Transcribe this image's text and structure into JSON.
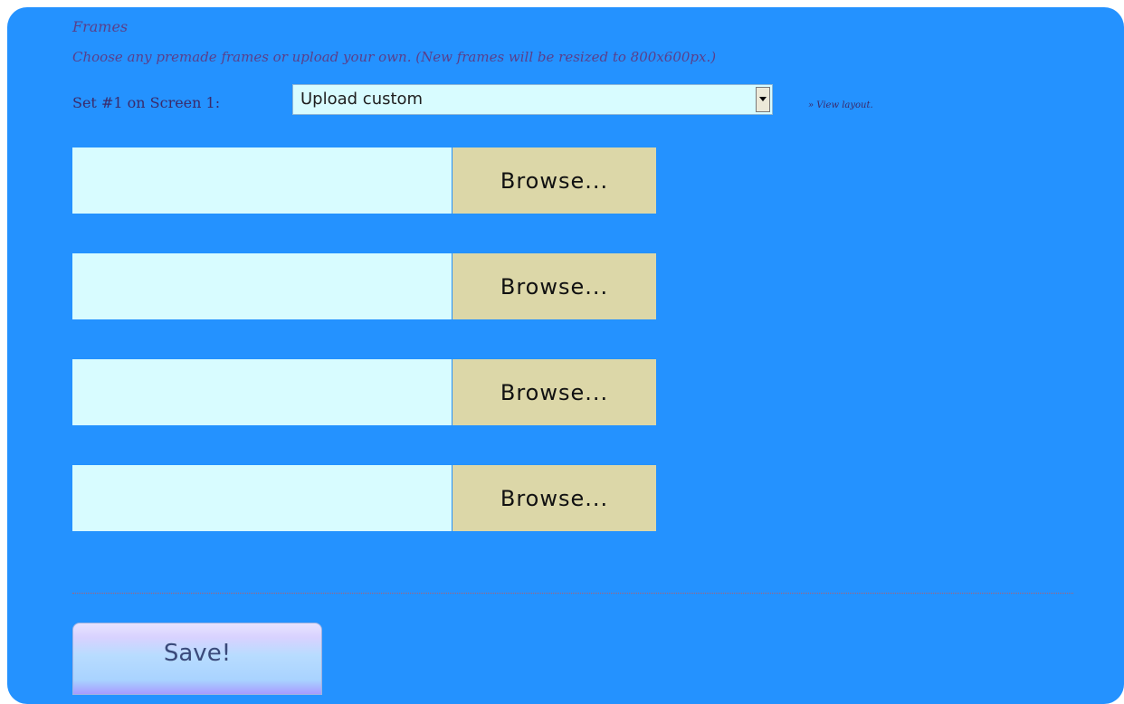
{
  "frames": {
    "title": "Frames",
    "description": "Choose any premade frames or upload your own. (New frames will be resized to 800x600px.)"
  },
  "set_selector": {
    "label": "Set #1 on Screen 1:",
    "selected_value": "Upload custom",
    "view_layout_link": "» View layout."
  },
  "uploads": [
    {
      "browse_label": "Browse...",
      "value": ""
    },
    {
      "browse_label": "Browse...",
      "value": ""
    },
    {
      "browse_label": "Browse...",
      "value": ""
    },
    {
      "browse_label": "Browse...",
      "value": ""
    }
  ],
  "actions": {
    "save_label": "Save!"
  },
  "colors": {
    "panel_background": "#2492ff",
    "field_background": "#d8fcff",
    "browse_button": "#dcd7a8",
    "heading_text": "#5a3f8a"
  }
}
